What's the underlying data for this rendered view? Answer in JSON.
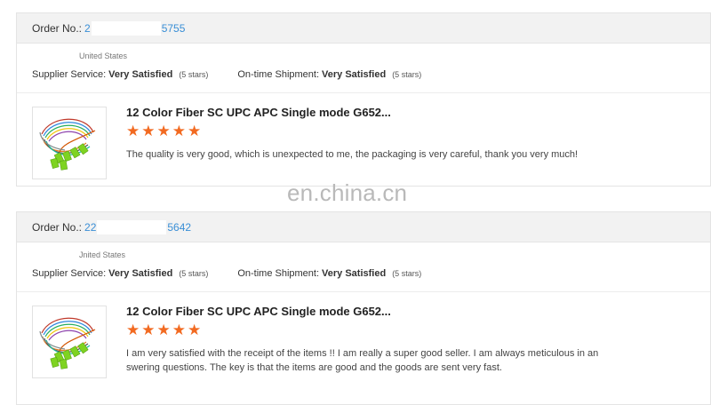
{
  "reviews": [
    {
      "order_label": "Order No.:",
      "order_prefix": "2",
      "order_suffix": "5755",
      "country": "United States",
      "supplier_service_label": "Supplier Service:",
      "supplier_service_value": "Very Satisfied",
      "supplier_service_stars": "(5 stars)",
      "shipment_label": "On-time Shipment:",
      "shipment_value": "Very Satisfied",
      "shipment_stars": "(5 stars)",
      "product_title": "12 Color Fiber SC UPC APC Single mode G652...",
      "rating": 5,
      "text": "The quality is very good, which is unexpected to me, the packaging is very careful, thank you very much!"
    },
    {
      "order_label": "Order No.:",
      "order_prefix": "22",
      "order_suffix": "5642",
      "country": "Jnited States",
      "supplier_service_label": "Supplier Service:",
      "supplier_service_value": "Very Satisfied",
      "supplier_service_stars": "(5 stars)",
      "shipment_label": "On-time Shipment:",
      "shipment_value": "Very Satisfied",
      "shipment_stars": "(5 stars)",
      "product_title": "12 Color Fiber SC UPC APC Single mode G652...",
      "rating": 5,
      "text": "I am very satisfied with the receipt of the items !! I am really a super good seller. I am always meticulous in an swering questions. The key is that the items are good and the goods are sent very fast."
    }
  ],
  "watermark": "en.china.cn",
  "colors": {
    "star": "#f26a21",
    "order_link": "#3a8fd6",
    "header_bg": "#f2f2f2"
  }
}
